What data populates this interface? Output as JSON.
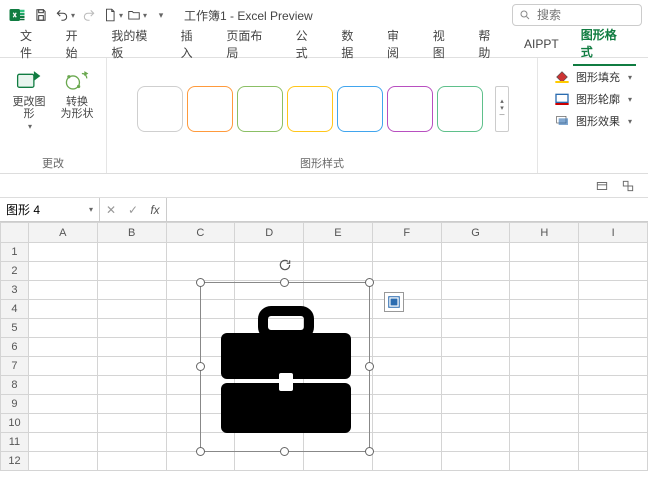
{
  "titlebar": {
    "title": "工作簿1  -  Excel Preview",
    "search_placeholder": "搜索"
  },
  "tabs": [
    "文件",
    "开始",
    "我的模板",
    "插入",
    "页面布局",
    "公式",
    "数据",
    "审阅",
    "视图",
    "帮助",
    "AIPPT",
    "图形格式"
  ],
  "active_tab": 11,
  "ribbon": {
    "group_change": {
      "label": "更改",
      "btn_change_shape": "更改图\n形",
      "btn_convert": "转换\n为形状"
    },
    "group_styles": {
      "label": "图形样式",
      "swatches": [
        "#cfcfcf",
        "#ff9a3c",
        "#8bbf65",
        "#ffc61a",
        "#41a5ee",
        "#b84fc0",
        "#5fc08b"
      ]
    },
    "group_format": {
      "fill": "图形填充",
      "outline": "图形轮廓",
      "effects": "图形效果"
    }
  },
  "namebox": {
    "value": "图形 4"
  },
  "columns": [
    "A",
    "B",
    "C",
    "D",
    "E",
    "F",
    "G",
    "H",
    "I"
  ],
  "rows": [
    1,
    2,
    3,
    4,
    5,
    6,
    7,
    8,
    9,
    10,
    11,
    12
  ],
  "chart_data": null
}
